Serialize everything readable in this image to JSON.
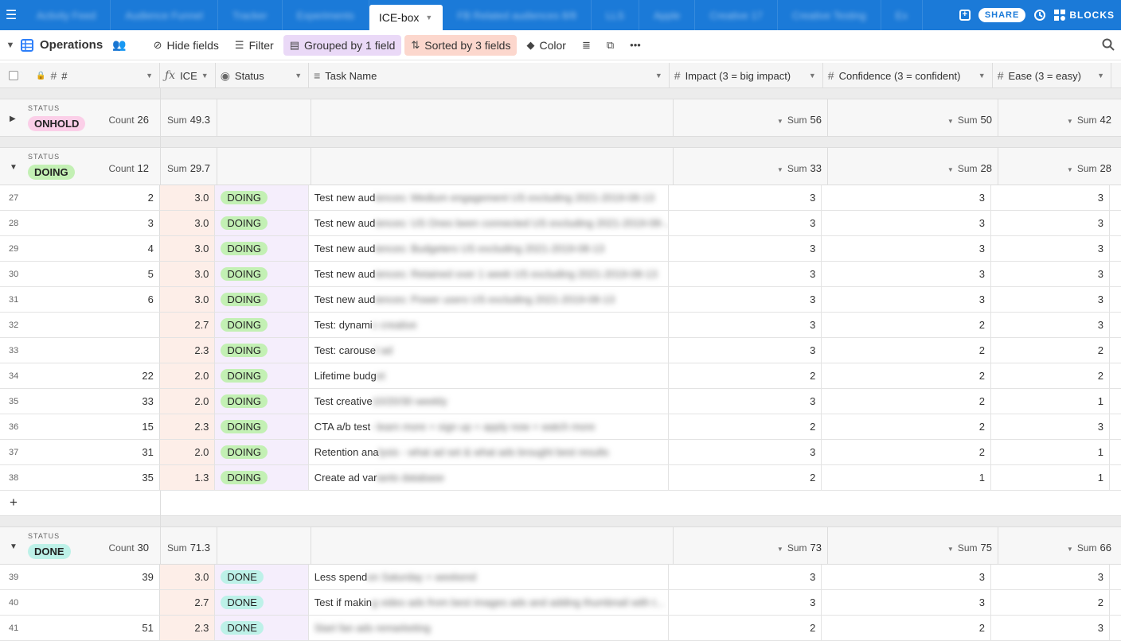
{
  "tabs": [
    {
      "label": "Activity Feed",
      "blurred": true
    },
    {
      "label": "Audience Funnel",
      "blurred": true
    },
    {
      "label": "Tracker",
      "blurred": true
    },
    {
      "label": "Experiments",
      "blurred": true
    },
    {
      "label": "ICE-box",
      "active": true
    },
    {
      "label": "FB Related audiences 8/8",
      "blurred": true
    },
    {
      "label": "LLS",
      "blurred": true
    },
    {
      "label": "Apple",
      "blurred": true
    },
    {
      "label": "Creative 17",
      "blurred": true
    },
    {
      "label": "Creative Testing",
      "blurred": true
    },
    {
      "label": "Ex",
      "blurred": true
    }
  ],
  "top_right": {
    "share_label": "SHARE",
    "blocks_label": "BLOCKS"
  },
  "toolbar": {
    "view_name": "Operations",
    "hide_fields": "Hide fields",
    "filter": "Filter",
    "grouped": "Grouped by 1 field",
    "sorted": "Sorted by 3 fields",
    "color": "Color"
  },
  "columns": {
    "number": "#",
    "ice": "ICE",
    "status": "Status",
    "task": "Task Name",
    "impact": "Impact (3 = big impact)",
    "confidence": "Confidence (3 = confident)",
    "ease": "Ease (3 = easy)"
  },
  "groups": [
    {
      "label": "STATUS",
      "value": "ONHOLD",
      "color": "#fbcfe8",
      "expanded": false,
      "count_label": "Count",
      "count": "26",
      "sum_label": "Sum",
      "ice_sum": "49.3",
      "impact_sum": "56",
      "confidence_sum": "50",
      "ease_sum": "42"
    },
    {
      "label": "STATUS",
      "value": "DOING",
      "color": "#c3f0b4",
      "expanded": true,
      "count_label": "Count",
      "count": "12",
      "sum_label": "Sum",
      "ice_sum": "29.7",
      "impact_sum": "33",
      "confidence_sum": "28",
      "ease_sum": "28",
      "rows": [
        {
          "rn": "27",
          "num": "2",
          "ice": "3.0",
          "status": "DOING",
          "task": "Test new aud",
          "task_blur": "iences: Medium engagement US excluding 2021-2019-08-13",
          "impact": "3",
          "conf": "3",
          "ease": "3"
        },
        {
          "rn": "28",
          "num": "3",
          "ice": "3.0",
          "status": "DOING",
          "task": "Test new aud",
          "task_blur": "iences: US Ones been connected US excluding 2021-2019-08-...",
          "impact": "3",
          "conf": "3",
          "ease": "3"
        },
        {
          "rn": "29",
          "num": "4",
          "ice": "3.0",
          "status": "DOING",
          "task": "Test new aud",
          "task_blur": "iences: Budgeters US excluding 2021-2019-08-13",
          "impact": "3",
          "conf": "3",
          "ease": "3"
        },
        {
          "rn": "30",
          "num": "5",
          "ice": "3.0",
          "status": "DOING",
          "task": "Test new aud",
          "task_blur": "iences: Retained over 1 week US excluding 2021-2019-08-13",
          "impact": "3",
          "conf": "3",
          "ease": "3"
        },
        {
          "rn": "31",
          "num": "6",
          "ice": "3.0",
          "status": "DOING",
          "task": "Test new aud",
          "task_blur": "iences: Power users US excluding 2021-2019-08-13",
          "impact": "3",
          "conf": "3",
          "ease": "3"
        },
        {
          "rn": "32",
          "num": "",
          "ice": "2.7",
          "status": "DOING",
          "task": "Test: dynami",
          "task_blur": "c creative",
          "impact": "3",
          "conf": "2",
          "ease": "3"
        },
        {
          "rn": "33",
          "num": "",
          "ice": "2.3",
          "status": "DOING",
          "task": "Test: carouse",
          "task_blur": "l ad",
          "impact": "3",
          "conf": "2",
          "ease": "2"
        },
        {
          "rn": "34",
          "num": "22",
          "ice": "2.0",
          "status": "DOING",
          "task": "Lifetime budg",
          "task_blur": "et",
          "impact": "2",
          "conf": "2",
          "ease": "2"
        },
        {
          "rn": "35",
          "num": "33",
          "ice": "2.0",
          "status": "DOING",
          "task": "Test creative",
          "task_blur": " 10/20/30 weekly",
          "impact": "3",
          "conf": "2",
          "ease": "1"
        },
        {
          "rn": "36",
          "num": "15",
          "ice": "2.3",
          "status": "DOING",
          "task": "CTA a/b test",
          "task_blur": " - learn more + sign up + apply now + watch more",
          "impact": "2",
          "conf": "2",
          "ease": "3"
        },
        {
          "rn": "37",
          "num": "31",
          "ice": "2.0",
          "status": "DOING",
          "task": "Retention ana",
          "task_blur": "lysis - what ad set & what ads brought best results",
          "impact": "3",
          "conf": "2",
          "ease": "1"
        },
        {
          "rn": "38",
          "num": "35",
          "ice": "1.3",
          "status": "DOING",
          "task": "Create ad var",
          "task_blur": "iants database",
          "impact": "2",
          "conf": "1",
          "ease": "1"
        }
      ]
    },
    {
      "label": "STATUS",
      "value": "DONE",
      "color": "#bdf1e8",
      "expanded": true,
      "count_label": "Count",
      "count": "30",
      "sum_label": "Sum",
      "ice_sum": "71.3",
      "impact_sum": "73",
      "confidence_sum": "75",
      "ease_sum": "66",
      "rows": [
        {
          "rn": "39",
          "num": "39",
          "ice": "3.0",
          "status": "DONE",
          "task": "Less spend",
          "task_blur": " on Saturday + weekend",
          "impact": "3",
          "conf": "3",
          "ease": "3"
        },
        {
          "rn": "40",
          "num": "",
          "ice": "2.7",
          "status": "DONE",
          "task": "Test if makin",
          "task_blur": "g video ads from best images ads and adding thumbnail with t...",
          "impact": "3",
          "conf": "3",
          "ease": "2"
        },
        {
          "rn": "41",
          "num": "51",
          "ice": "2.3",
          "status": "DONE",
          "task": "",
          "task_blur": "Start fan ads remarketing",
          "impact": "2",
          "conf": "2",
          "ease": "3"
        }
      ]
    }
  ],
  "add_row_label": "+"
}
